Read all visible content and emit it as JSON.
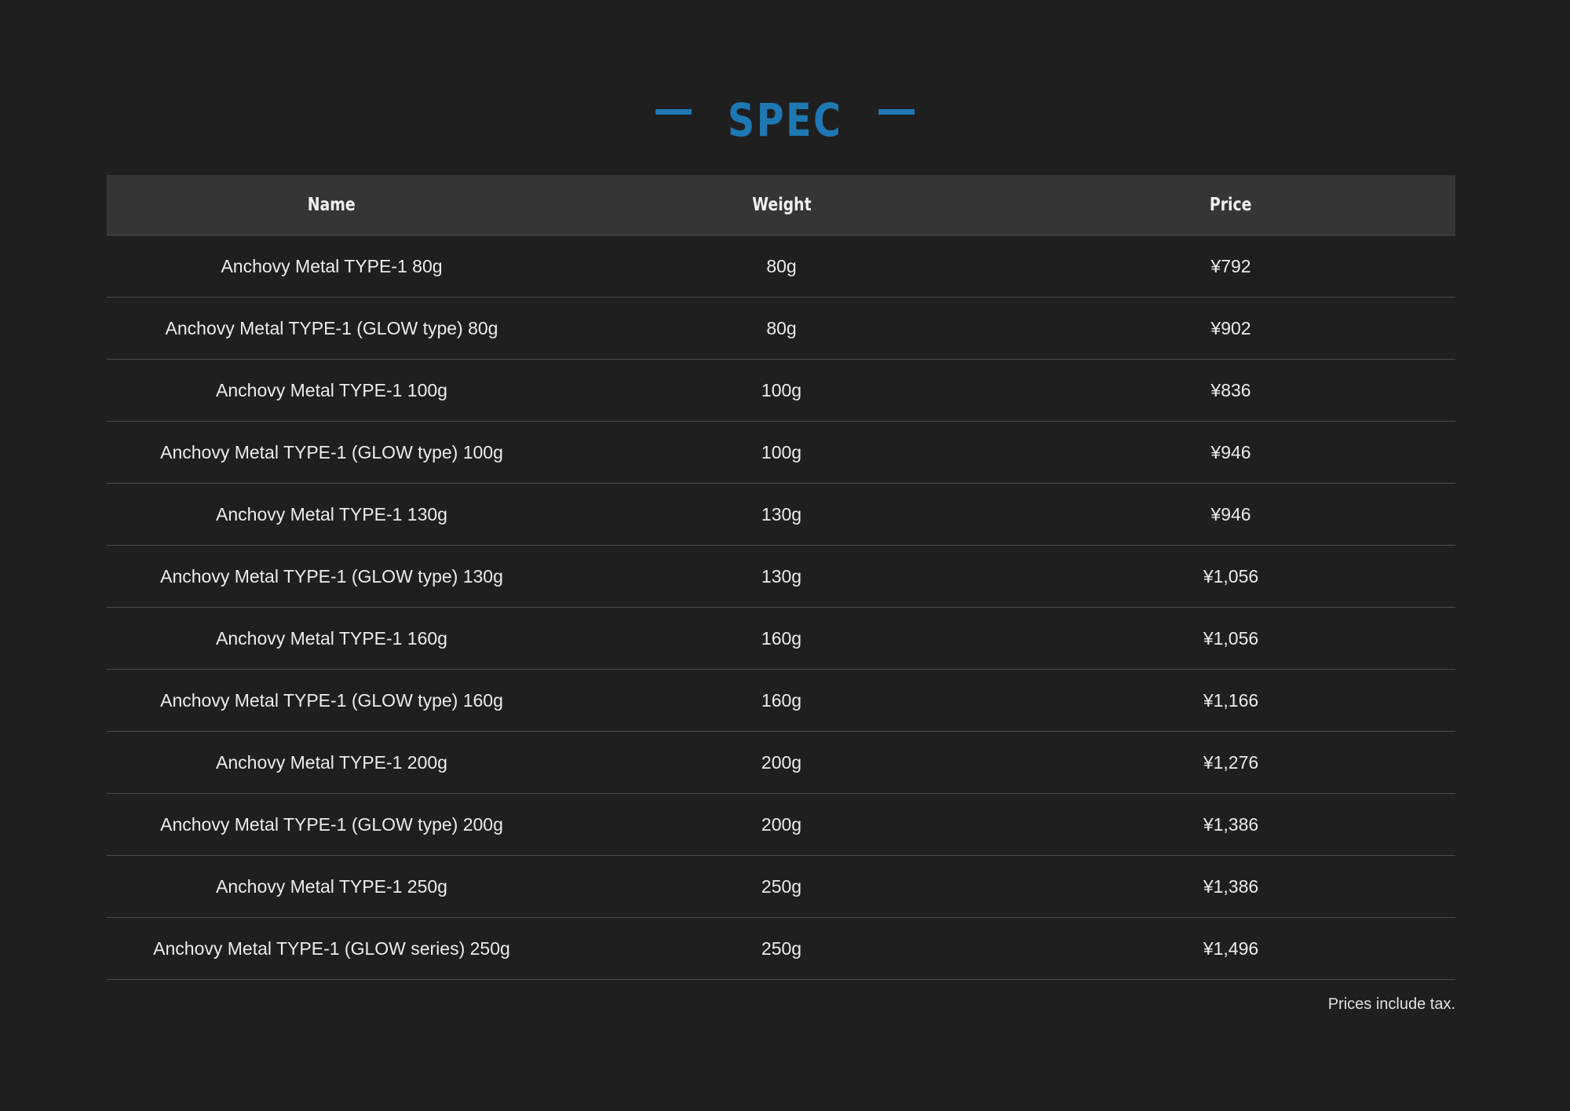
{
  "heading": {
    "title": "SPEC"
  },
  "table": {
    "headers": [
      "Name",
      "Weight",
      "Price"
    ],
    "rows": [
      [
        "Anchovy Metal TYPE-1 80g",
        "80g",
        "¥792"
      ],
      [
        "Anchovy Metal TYPE-1 (GLOW type) 80g",
        "80g",
        "¥902"
      ],
      [
        "Anchovy Metal TYPE-1 100g",
        "100g",
        "¥836"
      ],
      [
        "Anchovy Metal TYPE-1 (GLOW type) 100g",
        "100g",
        "¥946"
      ],
      [
        "Anchovy Metal TYPE-1 130g",
        "130g",
        "¥946"
      ],
      [
        "Anchovy Metal TYPE-1 (GLOW type) 130g",
        "130g",
        "¥1,056"
      ],
      [
        "Anchovy Metal TYPE-1 160g",
        "160g",
        "¥1,056"
      ],
      [
        "Anchovy Metal TYPE-1 (GLOW type) 160g",
        "160g",
        "¥1,166"
      ],
      [
        "Anchovy Metal TYPE-1 200g",
        "200g",
        "¥1,276"
      ],
      [
        "Anchovy Metal TYPE-1 (GLOW type) 200g",
        "200g",
        "¥1,386"
      ],
      [
        "Anchovy Metal TYPE-1 250g",
        "250g",
        "¥1,386"
      ],
      [
        "Anchovy Metal TYPE-1 (GLOW series) 250g",
        "250g",
        "¥1,496"
      ]
    ]
  },
  "footer": {
    "note": "Prices include tax."
  },
  "colors": {
    "background": "#1f1f1f",
    "accent": "#1e78b4",
    "header_background": "#353535",
    "divider": "#4a4a4a"
  }
}
